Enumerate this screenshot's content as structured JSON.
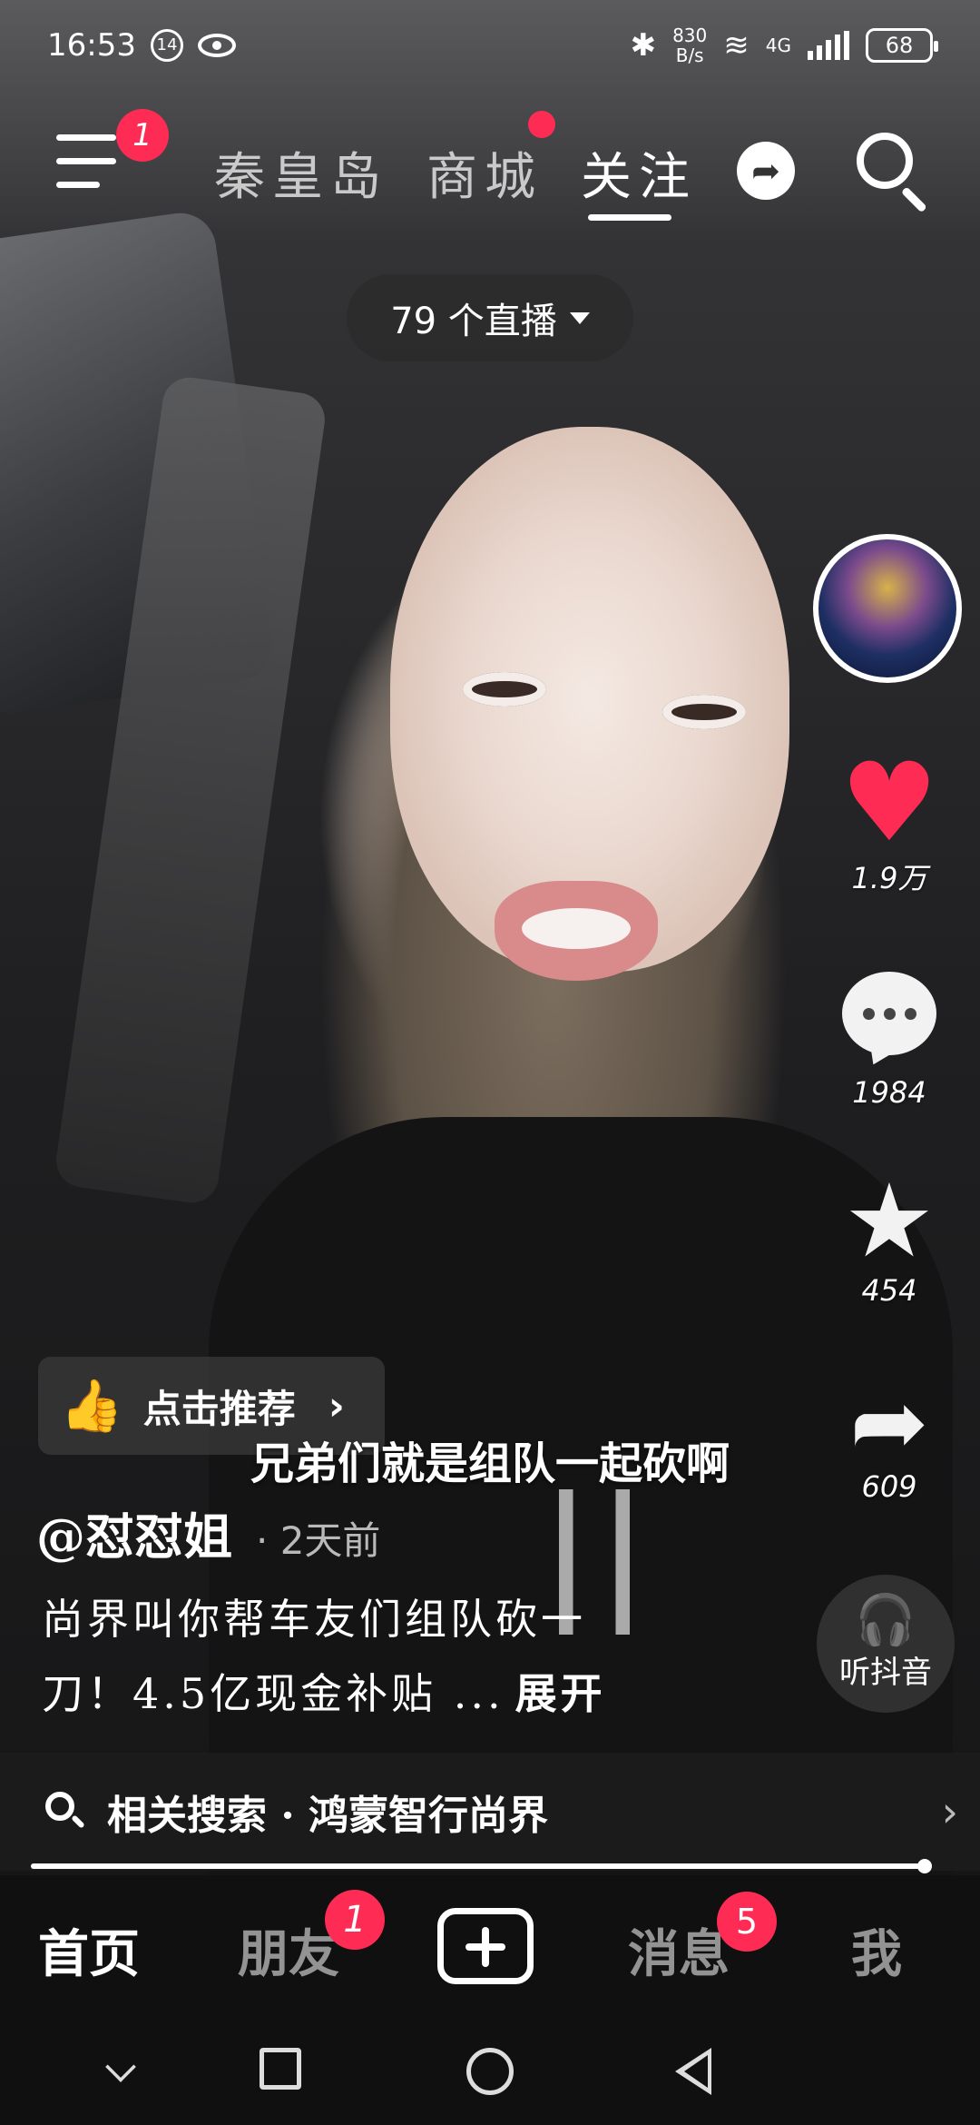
{
  "status_bar": {
    "time": "16:53",
    "net_speed_value": "830",
    "net_speed_unit": "B/s",
    "network": "4G",
    "battery": "68",
    "icons": [
      "notification-14-icon",
      "eye-icon",
      "bluetooth-icon",
      "wifi-icon",
      "signal-icon",
      "battery-icon"
    ]
  },
  "top_nav": {
    "menu_badge": "1",
    "tabs": [
      {
        "label": "秦皇岛",
        "active": false
      },
      {
        "label": "商城",
        "active": false,
        "has_dot": true
      },
      {
        "label": "关注",
        "active": true
      }
    ]
  },
  "live_pill": {
    "label": "79 个直播"
  },
  "rail": {
    "like_count": "1.9万",
    "comment_count": "1984",
    "favorite_count": "454",
    "share_count": "609",
    "listen_label": "听抖音"
  },
  "overlay": {
    "recommend_label": "点击推荐",
    "subtitle": "兄弟们就是组队一起砍啊",
    "author_name": "@怼怼姐",
    "post_time": "· 2天前",
    "description_line1": "尚界叫你帮车友们组队砍一",
    "description_line2": "刀！4.5亿现金补贴 ...",
    "expand_label": "展开",
    "related_search": "相关搜索 · 鸿蒙智行尚界"
  },
  "progress": {
    "fraction": 0.997
  },
  "tabbar": {
    "home": "首页",
    "friends": "朋友",
    "friends_badge": "1",
    "messages": "消息",
    "messages_badge": "5",
    "me": "我"
  },
  "colors": {
    "accent": "#fe2c55",
    "tabbar_bg": "#101010"
  }
}
